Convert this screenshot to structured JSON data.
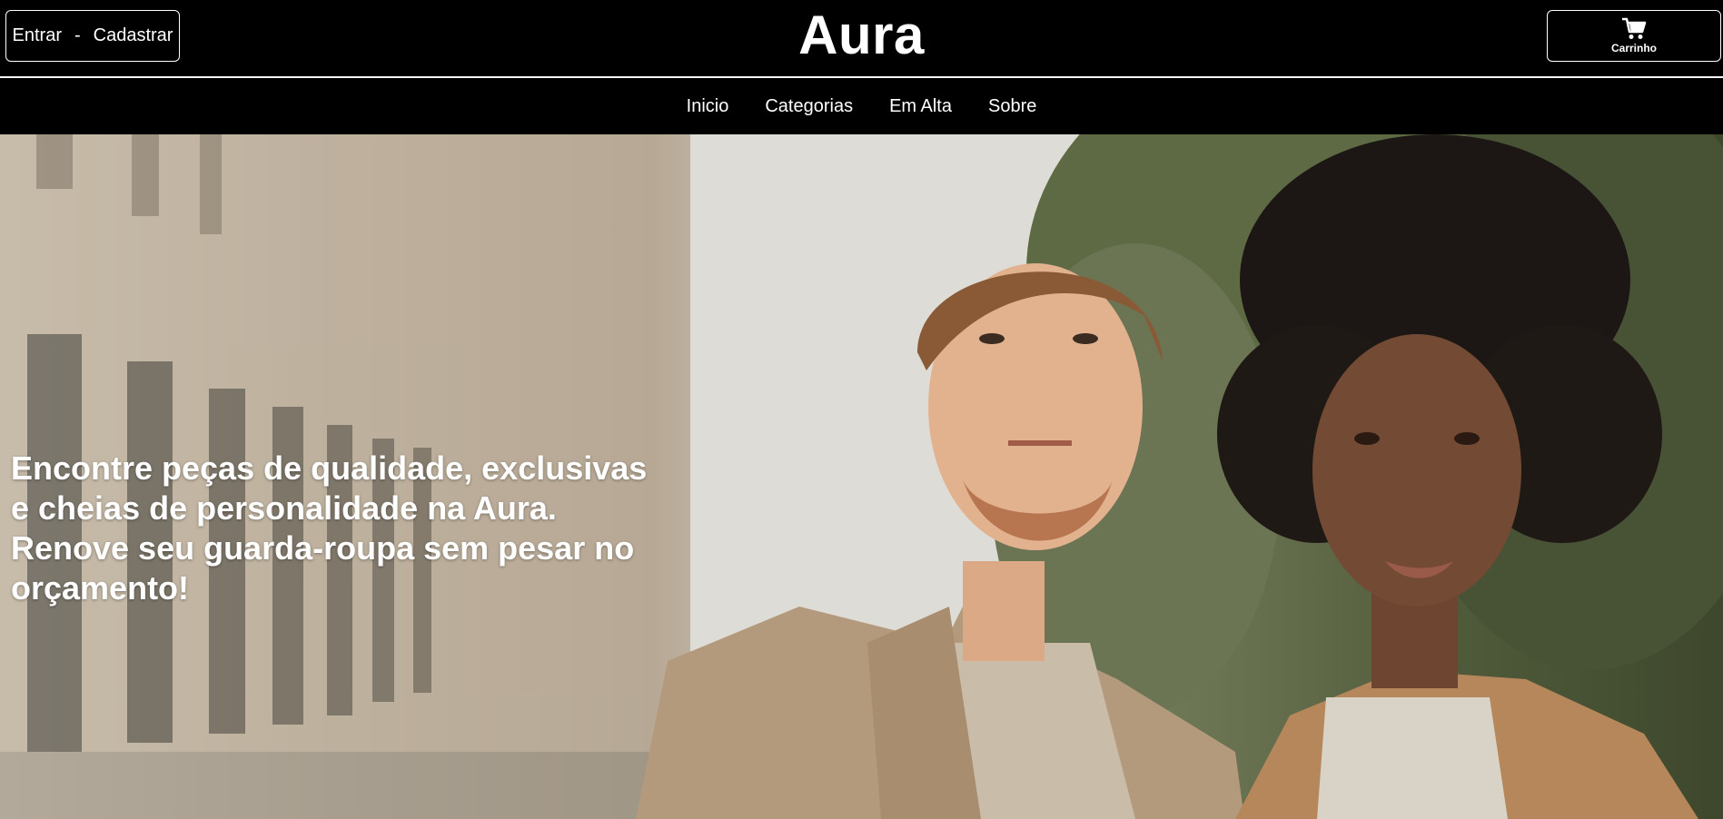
{
  "header": {
    "login_label": "Entrar",
    "separator": "-",
    "signup_label": "Cadastrar",
    "brand": "Aura",
    "cart_label": "Carrinho",
    "cart_icon": "cart-icon"
  },
  "nav": {
    "items": [
      {
        "label": "Inicio"
      },
      {
        "label": "Categorias"
      },
      {
        "label": "Em Alta"
      },
      {
        "label": "Sobre"
      }
    ]
  },
  "hero": {
    "lines": [
      "Encontre peças de qualidade, exclusivas",
      "e cheias de personalidade na Aura.",
      "Renove seu guarda-roupa sem pesar no",
      "orçamento!"
    ]
  },
  "colors": {
    "background": "#000000",
    "text": "#ffffff",
    "jacket": "#b49a7c",
    "foliage": "#4f5a3a"
  }
}
